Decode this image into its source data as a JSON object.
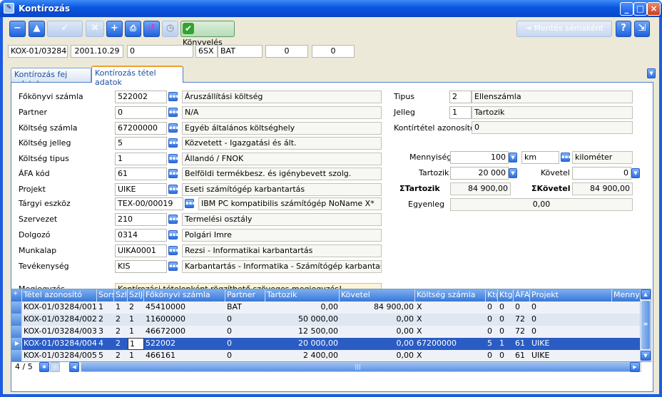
{
  "window": {
    "title": "Kontírozás"
  },
  "toolbar": {
    "posting_label": "Könyvelés",
    "save_schema_label": "Mentés sémaként"
  },
  "header_fields": [
    "KOX-01/03284",
    "2001.10.29",
    "0",
    "6SX",
    "BAT",
    "0",
    "0"
  ],
  "tabs": [
    {
      "label": "Kontírozás fej adatok"
    },
    {
      "label": "Kontírozás tétel adatok"
    }
  ],
  "left_form": [
    {
      "label": "Főkönyvi számla",
      "code": "522002",
      "desc": "Áruszállítási költség"
    },
    {
      "label": "Partner",
      "code": "0",
      "desc": "N/A"
    },
    {
      "label": "Költség számla",
      "code": "67200000",
      "desc": "Egyéb általános költséghely"
    },
    {
      "label": "Költség jelleg",
      "code": "5",
      "desc": "Közvetett - Igazgatási és ált."
    },
    {
      "label": "Költség tipus",
      "code": "1",
      "desc": "Állandó / FNOK"
    },
    {
      "label": "ÁFA kód",
      "code": "61",
      "desc": "Belföldi termékbesz. és igénybevett szolg."
    },
    {
      "label": "Projekt",
      "code": "UIKE",
      "desc": "Eseti számítógép karbantartás"
    },
    {
      "label": "Tárgyi eszköz",
      "code": "TEX-00/00019",
      "desc": "IBM PC kompatibilis számítógép NoName X*"
    },
    {
      "label": "Szervezet",
      "code": "210",
      "desc": "Termelési osztály"
    },
    {
      "label": "Dolgozó",
      "code": "0314",
      "desc": "Polgári Imre"
    },
    {
      "label": "Munkalap",
      "code": "UIKA0001",
      "desc": "Rezsi - Informatikai karbantartás"
    },
    {
      "label": "Tevékenység",
      "code": "KIS",
      "desc": "Karbantartás - Informatika - Számítógép karbantart"
    }
  ],
  "note": {
    "label": "Megjegyzés",
    "value": "Kontírozási tételenként rögzíthető szöveges megjegyzés!"
  },
  "right_form": {
    "tipus": {
      "label": "Tipus",
      "code": "2",
      "desc": "Ellenszámla"
    },
    "jelleg": {
      "label": "Jelleg",
      "code": "1",
      "desc": "Tartozik"
    },
    "azonosito": {
      "label": "Kontírtétel azonosító",
      "value": "0"
    },
    "mennyiseg": {
      "label": "Mennyiség",
      "value": "100",
      "unit_code": "km",
      "unit_desc": "kilométer"
    },
    "tartozik": {
      "label": "Tartozik",
      "value": "20 000"
    },
    "kovetel": {
      "label": "Követel",
      "value": "0"
    },
    "sum_tartozik": {
      "label": "ΣTartozik",
      "value": "84 900,00"
    },
    "sum_kovetel": {
      "label": "ΣKövetel",
      "value": "84 900,00"
    },
    "egyenleg": {
      "label": "Egyenleg",
      "value": "0,00"
    }
  },
  "grid": {
    "columns": [
      "Tétel azonosító",
      "Sorsz.",
      "SzlTip",
      "SzlJel",
      "Főkönyvi számla",
      "Partner",
      "Tartozik",
      "Követel",
      "Költség számla",
      "KtgJel",
      "KtgTip",
      "ÁFA kód",
      "Projekt",
      "Menny"
    ],
    "rows": [
      [
        "KOX-01/03284/001",
        "1",
        "1",
        "2",
        "45410000",
        "BAT",
        "0,00",
        "84 900,00",
        "X",
        "0",
        "0",
        "0",
        "0",
        ""
      ],
      [
        "KOX-01/03284/002",
        "2",
        "2",
        "1",
        "11600000",
        "0",
        "50 000,00",
        "0,00",
        "X",
        "0",
        "0",
        "72",
        "0",
        ""
      ],
      [
        "KOX-01/03284/003",
        "3",
        "2",
        "1",
        "46672000",
        "0",
        "12 500,00",
        "0,00",
        "X",
        "0",
        "0",
        "72",
        "0",
        ""
      ],
      [
        "KOX-01/03284/004",
        "4",
        "2",
        "1",
        "522002",
        "0",
        "20 000,00",
        "0,00",
        "67200000",
        "5",
        "1",
        "61",
        "UIKE",
        ""
      ],
      [
        "KOX-01/03284/005",
        "5",
        "2",
        "1",
        "466161",
        "0",
        "2 400,00",
        "0,00",
        "X",
        "0",
        "0",
        "61",
        "UIKE",
        ""
      ]
    ],
    "selected_row": 3,
    "record_counter": "4 / 5"
  }
}
